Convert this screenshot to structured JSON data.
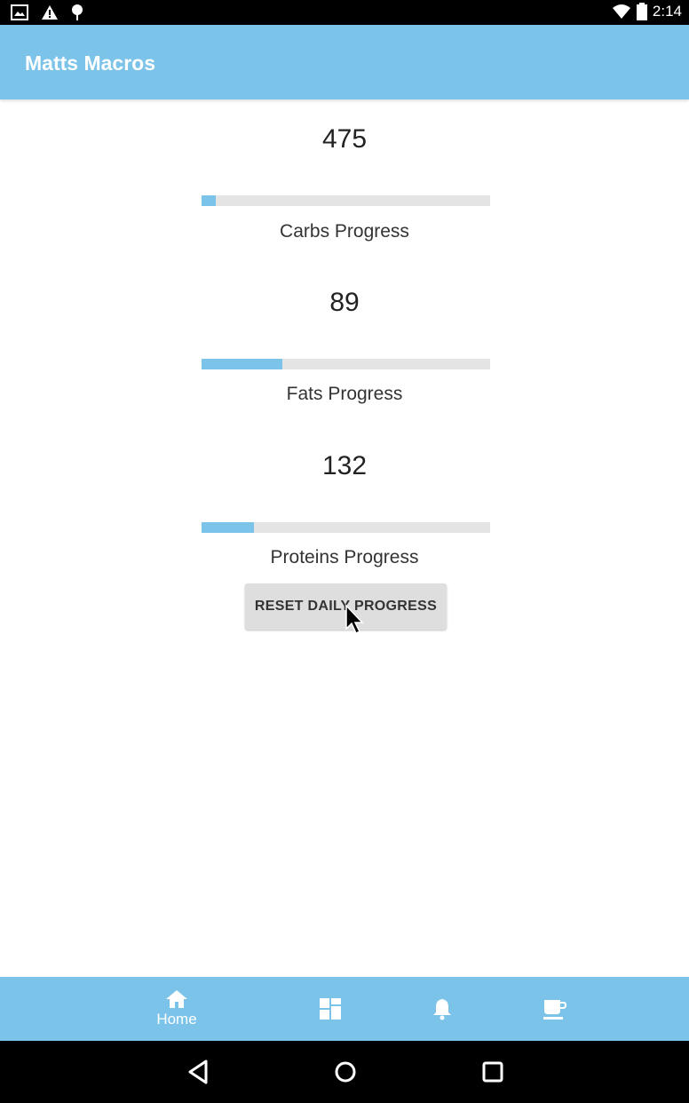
{
  "status_bar": {
    "time": "2:14"
  },
  "app_bar": {
    "title": "Matts Macros"
  },
  "macros": [
    {
      "value": "475",
      "label": "Carbs Progress",
      "progress": 0.05
    },
    {
      "value": "89",
      "label": "Fats Progress",
      "progress": 0.28
    },
    {
      "value": "132",
      "label": "Proteins Progress",
      "progress": 0.18
    }
  ],
  "reset_button": {
    "label": "RESET DAILY PROGRESS"
  },
  "bottom_nav": {
    "items": [
      {
        "icon": "home-icon",
        "label": "Home",
        "selected": true
      },
      {
        "icon": "dashboard-icon",
        "label": ""
      },
      {
        "icon": "bell-icon",
        "label": ""
      },
      {
        "icon": "coffee-cup-icon",
        "label": ""
      }
    ]
  },
  "colors": {
    "accent": "#7bc3e8",
    "track": "#e4e4e4",
    "button": "#dedede"
  }
}
